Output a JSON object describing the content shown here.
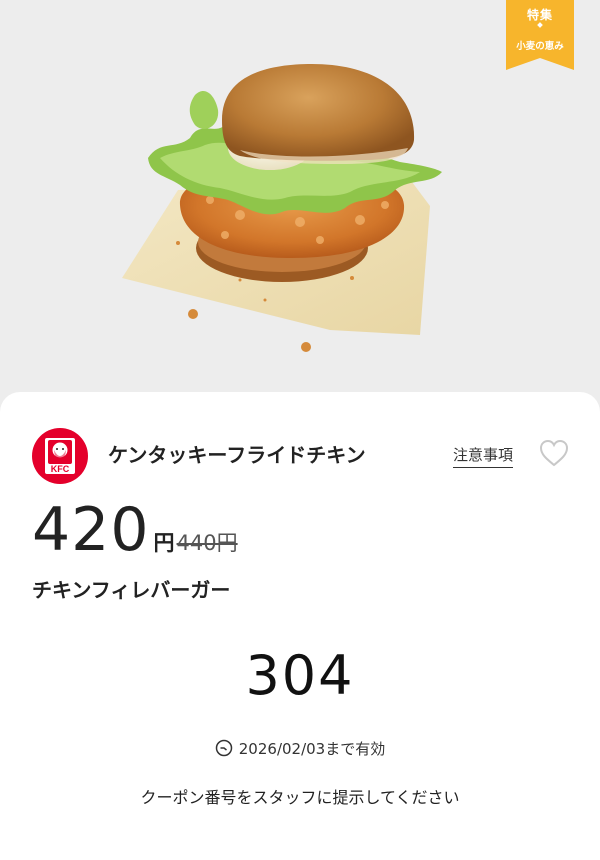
{
  "hero": {
    "image": "chicken-fillet-burger-photo",
    "ribbon": {
      "line1": "特集",
      "line2": "小麦の恵み",
      "color": "#f7b52c"
    }
  },
  "coupon": {
    "brand": {
      "logo": "kfc-logo",
      "logo_text": "KFC",
      "name": "ケンタッキーフライドチキン",
      "color": "#e4002b"
    },
    "notes_label": "注意事項",
    "favorite_icon": "heart-outline-icon",
    "price": "420",
    "price_unit": "円",
    "original_price": "440円",
    "product_name": "チキンフィレバーガー",
    "coupon_number": "304",
    "validity_icon": "clock-icon",
    "validity": "2026/02/03まで有効",
    "instruction": "クーポン番号をスタッフに提示してください"
  }
}
